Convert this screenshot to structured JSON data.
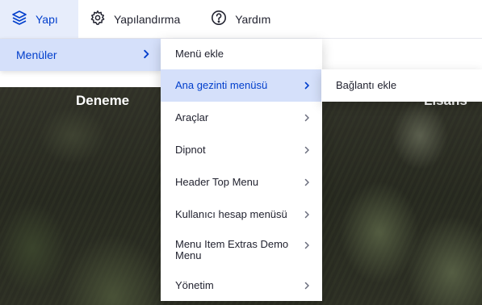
{
  "toolbar": {
    "items": [
      {
        "label": "Yapı",
        "icon": "layers-icon",
        "active": true
      },
      {
        "label": "Yapılandırma",
        "icon": "gear-icon",
        "active": false
      },
      {
        "label": "Yardım",
        "icon": "help-circle-icon",
        "active": false
      }
    ]
  },
  "tray": {
    "level1": {
      "label": "Menüler",
      "icon": "chevron-right-icon"
    },
    "level2": [
      {
        "label": "Menü ekle",
        "has_submenu": false
      },
      {
        "label": "Ana gezinti menüsü",
        "has_submenu": true,
        "active": true
      },
      {
        "label": "Araçlar",
        "has_submenu": true
      },
      {
        "label": "Dipnot",
        "has_submenu": true
      },
      {
        "label": "Header Top Menu",
        "has_submenu": true
      },
      {
        "label": "Kullanıcı hesap menüsü",
        "has_submenu": true
      },
      {
        "label": "Menu Item Extras Demo Menu",
        "has_submenu": true
      },
      {
        "label": "Yönetim",
        "has_submenu": true
      }
    ],
    "level3": [
      {
        "label": "Bağlantı ekle"
      }
    ]
  },
  "page": {
    "hero_left": "Deneme",
    "hero_right": "Lisans"
  },
  "colors": {
    "accent": "#003ecc",
    "highlight_bg": "#d5e0fa",
    "toolbar_active_bg": "#e7edfb"
  }
}
